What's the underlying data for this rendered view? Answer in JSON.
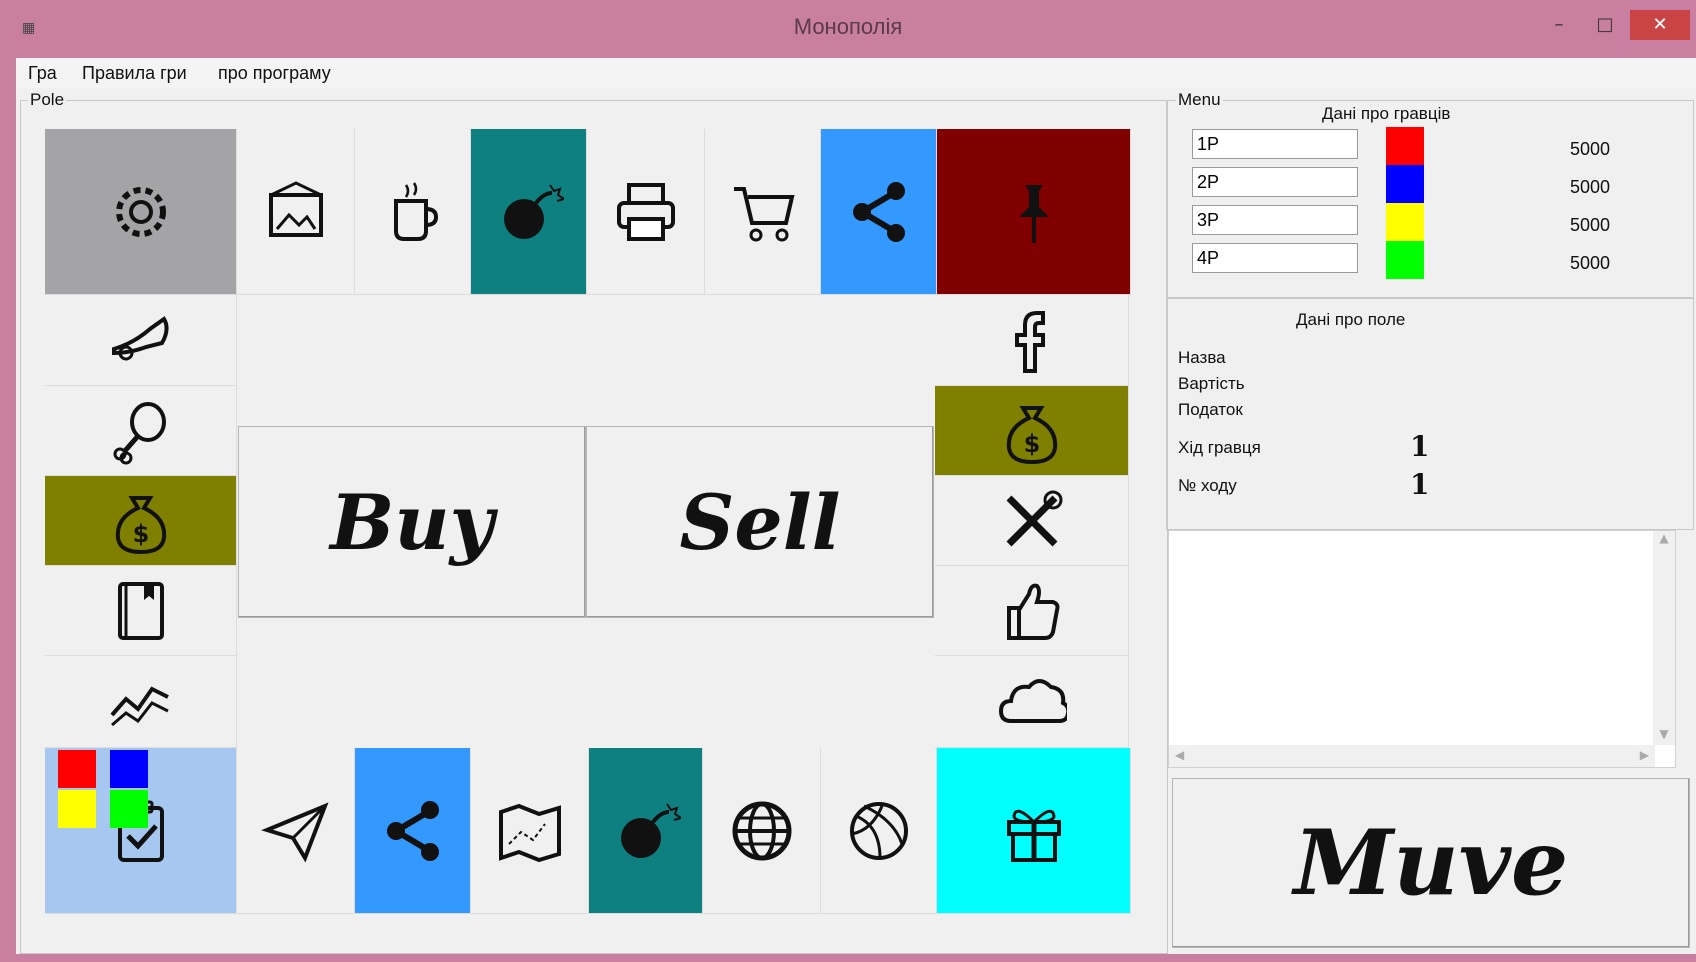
{
  "window": {
    "title": "Монополія"
  },
  "menu": [
    "Гра",
    "Правила гри",
    "про програму"
  ],
  "board": {
    "group_label": "Pole",
    "buy_label": "Buy",
    "sell_label": "Sell",
    "tiles": {
      "top": [
        {
          "icon": "gear-icon",
          "color": "#a4a4a6"
        },
        {
          "icon": "picture-icon",
          "color": "#f0f0f0"
        },
        {
          "icon": "coffee-icon",
          "color": "#f0f0f0"
        },
        {
          "icon": "bomb-icon",
          "color": "#0e8080"
        },
        {
          "icon": "printer-icon",
          "color": "#f0f0f0"
        },
        {
          "icon": "cart-icon",
          "color": "#f0f0f0"
        },
        {
          "icon": "share-icon",
          "color": "#3399ff"
        },
        {
          "icon": "pin-icon",
          "color": "#800000"
        }
      ],
      "left": [
        {
          "icon": "trumpet-icon",
          "color": "#f0f0f0"
        },
        {
          "icon": "drumstick-icon",
          "color": "#f0f0f0"
        },
        {
          "icon": "money-bag-icon",
          "color": "#808000"
        },
        {
          "icon": "book-icon",
          "color": "#f0f0f0"
        },
        {
          "icon": "graph-icon",
          "color": "#f0f0f0"
        }
      ],
      "right": [
        {
          "icon": "facebook-icon",
          "color": "#f0f0f0"
        },
        {
          "icon": "money-bag-icon",
          "color": "#808000"
        },
        {
          "icon": "tools-icon",
          "color": "#f0f0f0"
        },
        {
          "icon": "thumbs-up-icon",
          "color": "#f0f0f0"
        },
        {
          "icon": "cloud-icon",
          "color": "#f0f0f0"
        }
      ],
      "bottom": [
        {
          "icon": "clipboard-check-icon",
          "color": "#a6c8f0"
        },
        {
          "icon": "paper-plane-icon",
          "color": "#f0f0f0"
        },
        {
          "icon": "share-icon",
          "color": "#3399ff"
        },
        {
          "icon": "map-icon",
          "color": "#f0f0f0"
        },
        {
          "icon": "bomb-icon",
          "color": "#0e8080"
        },
        {
          "icon": "globe-icon",
          "color": "#f0f0f0"
        },
        {
          "icon": "basketball-icon",
          "color": "#f0f0f0"
        },
        {
          "icon": "gift-icon",
          "color": "#00ffff"
        }
      ]
    },
    "tokens": [
      "#ff0000",
      "#0000ff",
      "#ffff00",
      "#00ff00"
    ]
  },
  "side": {
    "group_label": "Menu",
    "players_title": "Дані про гравців",
    "players": [
      {
        "name": "1P",
        "color": "#ff0000",
        "money": "5000"
      },
      {
        "name": "2P",
        "color": "#0000ff",
        "money": "5000"
      },
      {
        "name": "3P",
        "color": "#ffff00",
        "money": "5000"
      },
      {
        "name": "4P",
        "color": "#00ff00",
        "money": "5000"
      }
    ],
    "field_title": "Дані про поле",
    "field_name_label": "Назва",
    "field_cost_label": "Вартість",
    "field_tax_label": "Податок",
    "turn_player_label": "Хід гравця",
    "turn_player_value": "1",
    "turn_number_label": "№ ходу",
    "turn_number_value": "1",
    "move_label": "Muve"
  }
}
